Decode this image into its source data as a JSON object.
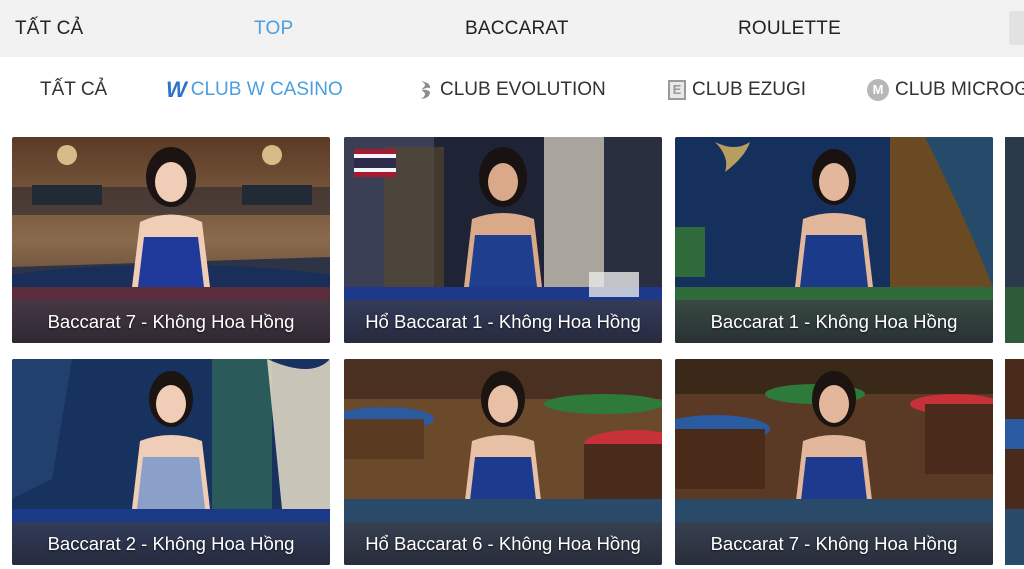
{
  "top_tabs": [
    {
      "label": "TẤT CẢ",
      "active": false
    },
    {
      "label": "TOP",
      "active": true
    },
    {
      "label": "BACCARAT",
      "active": false
    },
    {
      "label": "ROULETTE",
      "active": false
    }
  ],
  "providers": [
    {
      "label": "TẤT CẢ",
      "icon": "grid-icon",
      "active": false
    },
    {
      "label": "CLUB W CASINO",
      "icon": "w-casino-logo-icon",
      "active": true
    },
    {
      "label": "CLUB EVOLUTION",
      "icon": "evolution-logo-icon",
      "active": false
    },
    {
      "label": "CLUB EZUGI",
      "icon": "ezugi-logo-icon",
      "active": false
    },
    {
      "label": "CLUB MICROG",
      "icon": "microgaming-logo-icon",
      "active": false
    }
  ],
  "games": [
    {
      "title": "Baccarat 7 - Không Hoa Hồng",
      "theme": "casino-hall"
    },
    {
      "title": "Hổ Baccarat 1 - Không Hoa Hồng",
      "theme": "thai-studio",
      "flag": "thailand"
    },
    {
      "title": "Baccarat 1 - Không Hoa Hồng",
      "theme": "butterfly-studio"
    },
    {
      "title": "Baccarat 2 - Không Hoa Hồng",
      "theme": "curtain-studio"
    },
    {
      "title": "Hổ Baccarat 6 - Không Hoa Hồng",
      "theme": "tables-room"
    },
    {
      "title": "Baccarat 7 - Không Hoa Hồng",
      "theme": "tables-room-2"
    }
  ],
  "colors": {
    "accent": "#4a9fe0",
    "text": "#222222",
    "bar_bg": "#f2f2f2"
  }
}
